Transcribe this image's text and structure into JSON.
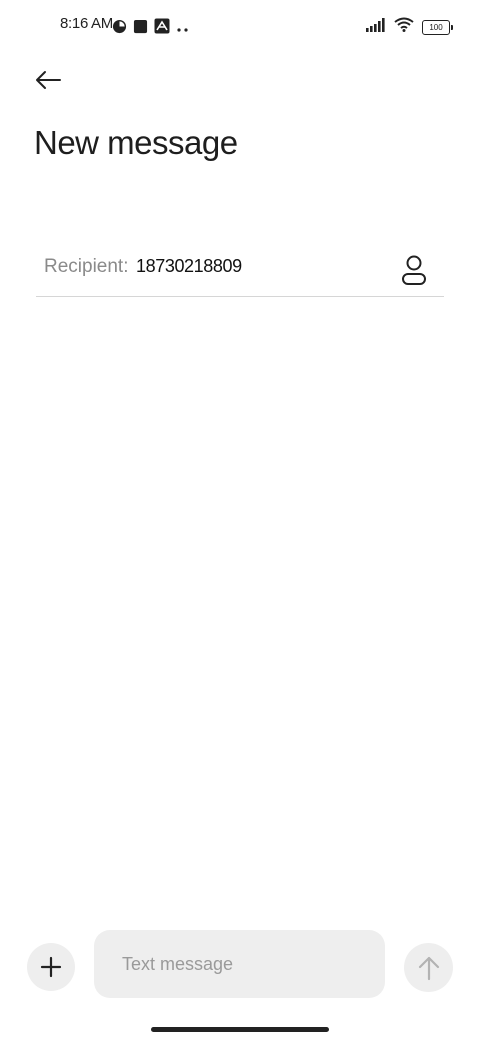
{
  "status_bar": {
    "time": "8:16 AM",
    "left_icons": [
      "pie-chart-icon",
      "square-app-icon",
      "app-logo-icon",
      "more-dots-icon"
    ],
    "right_icons": [
      "signal-icon",
      "wifi-icon",
      "battery-icon"
    ],
    "battery_level": "100"
  },
  "header": {
    "back_icon": "arrow-left-icon",
    "title": "New message"
  },
  "recipient": {
    "label": "Recipient:",
    "value": "18730218809",
    "contact_icon": "person-icon"
  },
  "composer": {
    "attach_icon": "plus-icon",
    "placeholder": "Text message",
    "value": "",
    "send_icon": "arrow-up-icon"
  },
  "colors": {
    "background": "#ffffff",
    "text": "#1a1a1a",
    "muted": "#8a8a8a",
    "input_bg": "#eeeeee",
    "divider": "#d6d6d6"
  }
}
